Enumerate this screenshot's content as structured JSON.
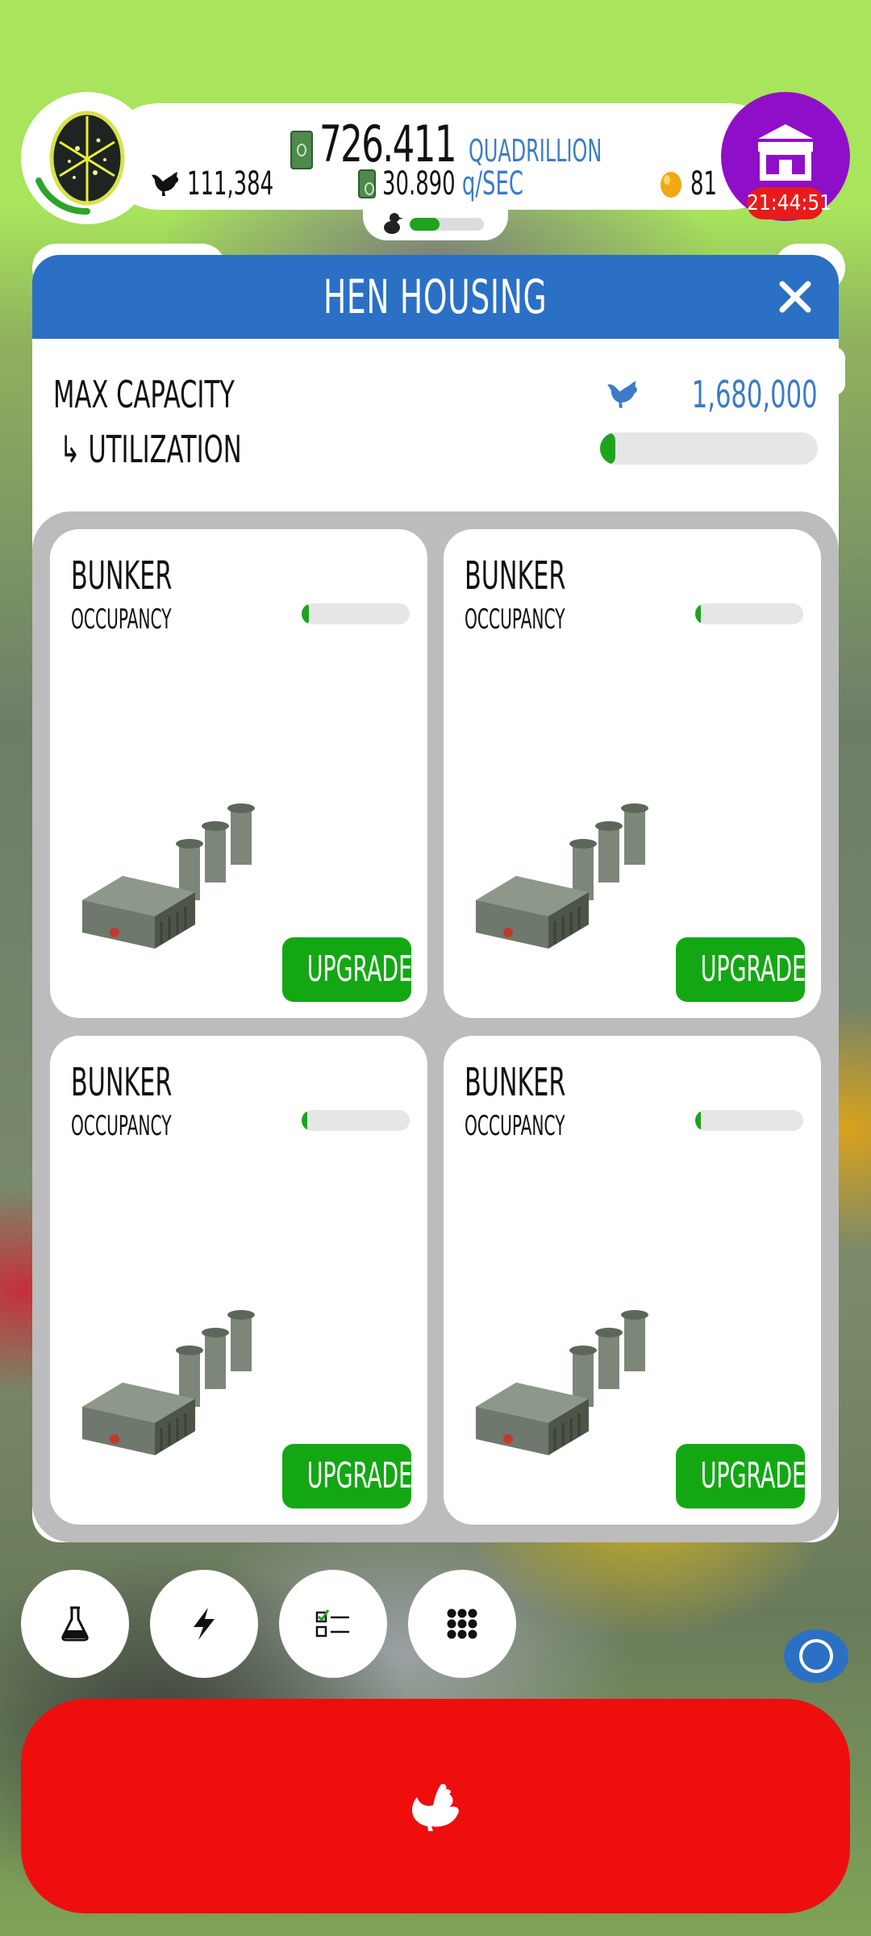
{
  "hud": {
    "money_value": "726.411",
    "money_unit": "QUADRILLION",
    "chicken_count": "111,384",
    "rate_value": "30.890",
    "rate_unit": "q/SEC",
    "golden_eggs": "81",
    "shop_timer": "21:44:51",
    "mini_progress_pct": 40
  },
  "modal": {
    "title": "HEN HOUSING",
    "max_capacity_label": "MAX CAPACITY",
    "utilization_label": "↳ UTILIZATION",
    "max_capacity_value": "1,680,000",
    "utilization_pct": 6
  },
  "cards": [
    {
      "title": "BUNKER",
      "occupancy_label": "OCCUPANCY",
      "occupancy_pct": 7,
      "button": "UPGRADE"
    },
    {
      "title": "BUNKER",
      "occupancy_label": "OCCUPANCY",
      "occupancy_pct": 5,
      "button": "UPGRADE"
    },
    {
      "title": "BUNKER",
      "occupancy_label": "OCCUPANCY",
      "occupancy_pct": 5,
      "button": "UPGRADE"
    },
    {
      "title": "BUNKER",
      "occupancy_label": "OCCUPANCY",
      "occupancy_pct": 5,
      "button": "UPGRADE"
    }
  ],
  "icons": {
    "research": "flask-icon",
    "boosts": "lightning-icon",
    "missions": "checklist-icon",
    "menu": "grid-icon",
    "hatch": "chicken-icon",
    "shop": "store-icon"
  },
  "colors": {
    "accent_blue": "#2b70c5",
    "upgrade_green": "#13a813",
    "hatch_red": "#ee0e0e",
    "shop_purple": "#8f0fc9"
  }
}
